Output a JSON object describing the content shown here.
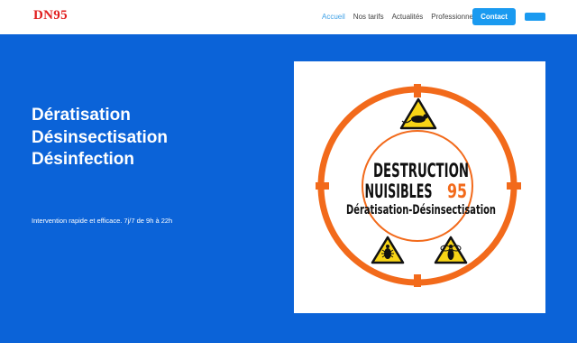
{
  "nav": {
    "logo": "DN95",
    "links": [
      {
        "label": "Accueil",
        "active": true
      },
      {
        "label": "Nos tarifs",
        "active": false
      },
      {
        "label": "Actualités",
        "active": false
      },
      {
        "label": "Professionnels",
        "active": false
      }
    ],
    "contact_label": "Contact"
  },
  "hero": {
    "title_lines": [
      "Dératisation",
      "Désinsectisation",
      "Désinfection"
    ],
    "subtitle": "Intervention rapide et efficace. 7j/7 de 9h à 22h"
  },
  "logo_image": {
    "line1": "DESTRUCTION",
    "line2": "NUISIBLES",
    "line2_number": "95",
    "line3": "Dératisation-Désinsectisation"
  },
  "colors": {
    "brand_red": "#e11f1f",
    "accent_blue": "#1a9af0",
    "hero_blue": "#0b63d8",
    "target_orange": "#f26a1b"
  }
}
